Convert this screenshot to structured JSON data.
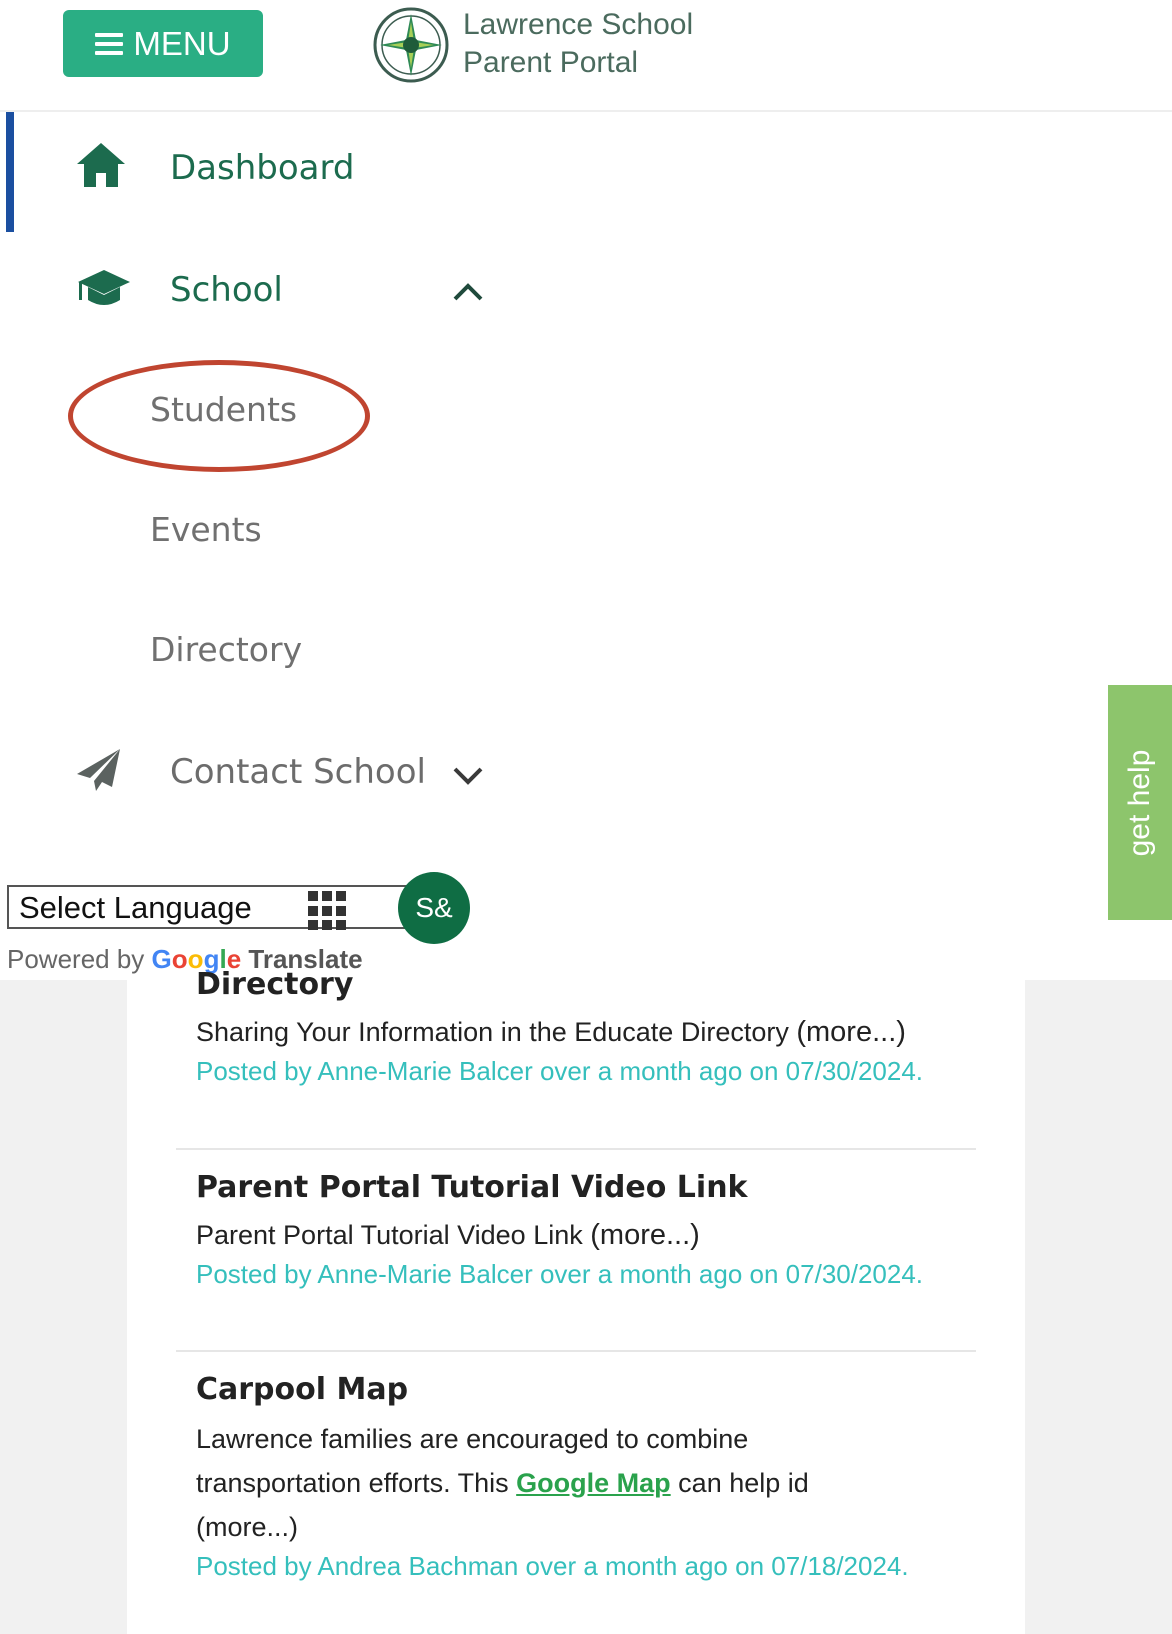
{
  "header": {
    "menu_label": "MENU",
    "brand_line1": "Lawrence School",
    "brand_line2": "Parent Portal"
  },
  "nav": {
    "dashboard": "Dashboard",
    "school": "School",
    "students": "Students",
    "events": "Events",
    "directory": "Directory",
    "contact": "Contact School"
  },
  "help_tab": "get help",
  "translate": {
    "select_label": "Select Language",
    "ext_badge": "S&",
    "powered_by": "Powered by",
    "google": [
      "G",
      "o",
      "o",
      "g",
      "l",
      "e"
    ],
    "translate_word": "Translate"
  },
  "posts": [
    {
      "title": "Directory",
      "body": "Sharing Your Information in the Educate Directory",
      "more": "(more...)",
      "meta": "Posted by Anne-Marie Balcer over a month ago on 07/30/2024."
    },
    {
      "title": "Parent Portal Tutorial Video Link",
      "body": "Parent Portal Tutorial Video Link",
      "more": "(more...)",
      "meta": "Posted by Anne-Marie Balcer over a month ago on 07/30/2024."
    },
    {
      "title": "Carpool Map",
      "body_line1": "Lawrence families are encouraged to combine",
      "body_line2_pre": "transportation efforts. This ",
      "body_link": "Google Map",
      "body_line2_post": " can help id",
      "more": "(more...)",
      "meta": "Posted by Andrea Bachman over a month ago on 07/18/2024."
    }
  ],
  "colors": {
    "accent_green": "#2aae84",
    "nav_green": "#1c6b4e",
    "meta_teal": "#35bfbc",
    "help_green": "#8dc56c",
    "annotation_red": "#c04530"
  }
}
